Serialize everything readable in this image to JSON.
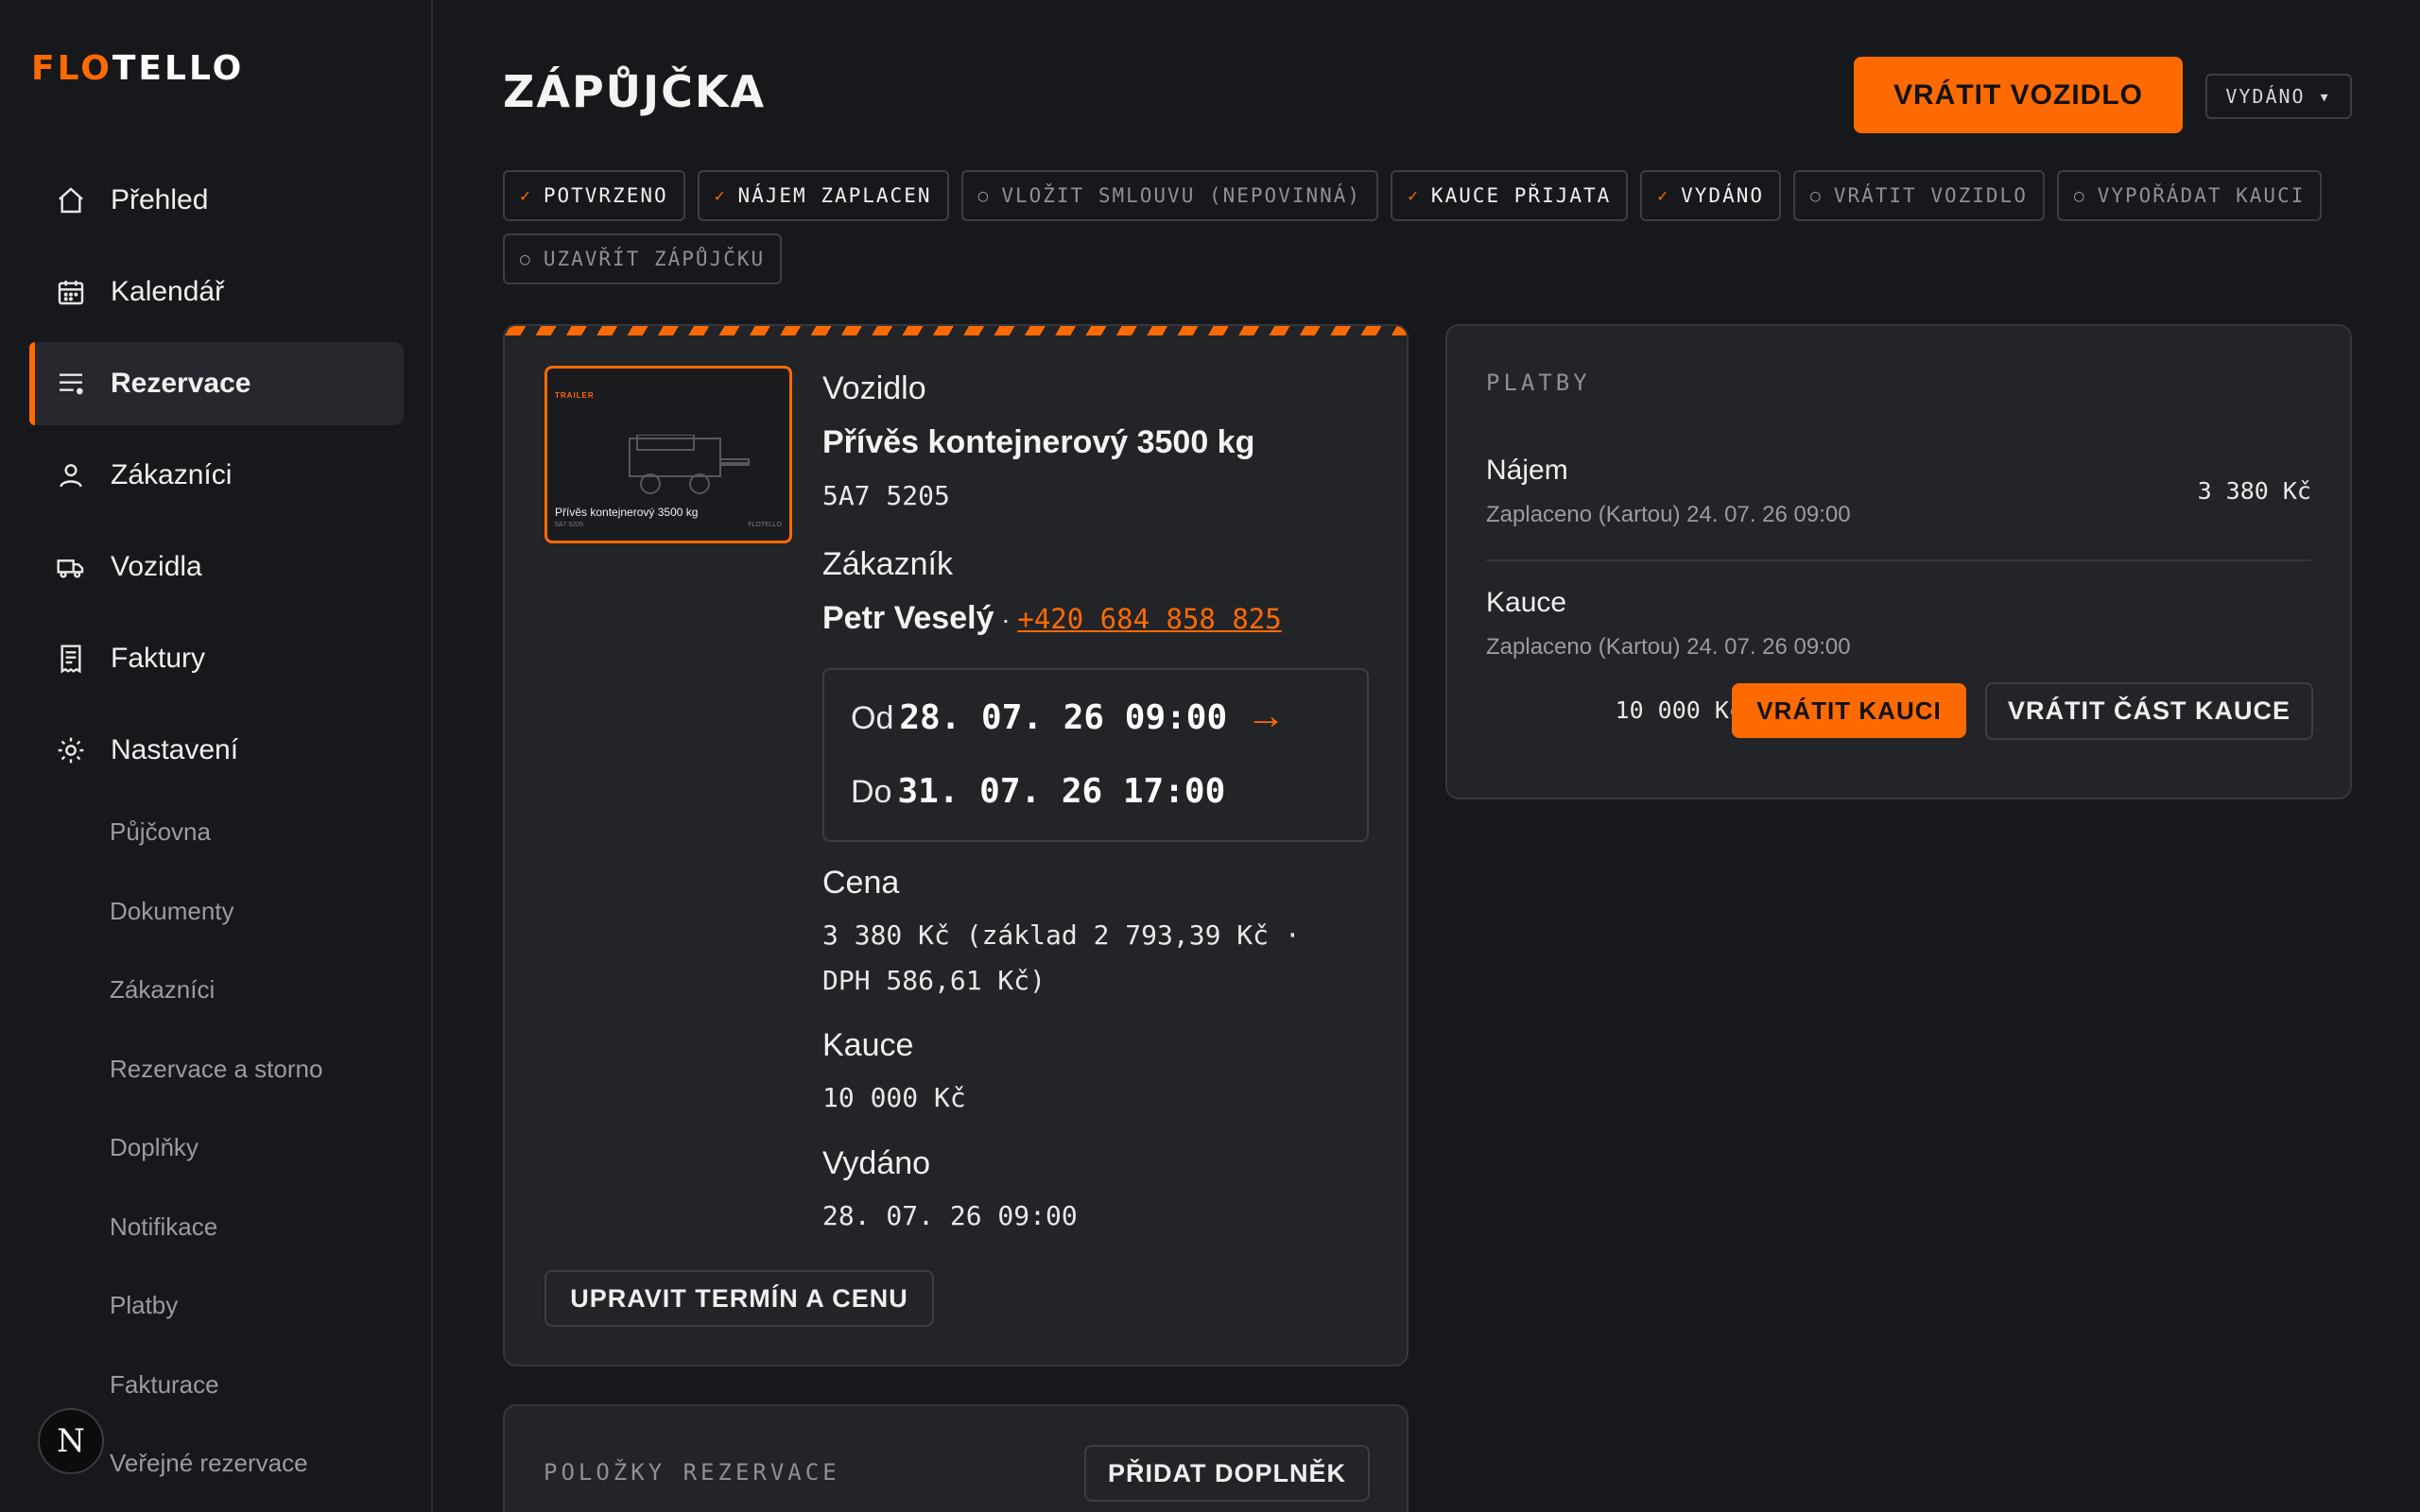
{
  "app": {
    "logo_a": "FLO",
    "logo_b": "TELLO",
    "avatar_letter": "N"
  },
  "sidebar": {
    "items": [
      {
        "label": "Přehled",
        "icon": "home-icon"
      },
      {
        "label": "Kalendář",
        "icon": "calendar-icon"
      },
      {
        "label": "Rezervace",
        "icon": "list-icon",
        "active": true
      },
      {
        "label": "Zákazníci",
        "icon": "user-icon"
      },
      {
        "label": "Vozidla",
        "icon": "truck-icon"
      },
      {
        "label": "Faktury",
        "icon": "receipt-icon"
      },
      {
        "label": "Nastavení",
        "icon": "gear-icon"
      }
    ],
    "subitems": [
      "Půjčovna",
      "Dokumenty",
      "Zákazníci",
      "Rezervace a storno",
      "Doplňky",
      "Notifikace",
      "Platby",
      "Fakturace",
      "Veřejné rezervace"
    ]
  },
  "header": {
    "title": "ZÁPŮJČKA",
    "return_button": "VRÁTIT VOZIDLO",
    "status_select": "VYDÁNO ▾"
  },
  "steps": [
    {
      "label": "POTVRZENO",
      "done": true,
      "mark": "✓"
    },
    {
      "label": "NÁJEM ZAPLACEN",
      "done": true,
      "mark": "✓"
    },
    {
      "label": "VLOŽIT SMLOUVU (NEPOVINNÁ)",
      "done": false,
      "mark": "○"
    },
    {
      "label": "KAUCE PŘIJATA",
      "done": true,
      "mark": "✓"
    },
    {
      "label": "VYDÁNO",
      "done": true,
      "mark": "✓"
    },
    {
      "label": "VRÁTIT VOZIDLO",
      "done": false,
      "mark": "○"
    },
    {
      "label": "VYPOŘÁDAT KAUCI",
      "done": false,
      "mark": "○"
    },
    {
      "label": "UZAVŘÍT ZÁPŮJČKU",
      "done": false,
      "mark": "○"
    }
  ],
  "vehicle": {
    "thumb_tag": "TRAILER",
    "thumb_name": "Přívěs kontejnerový 3500 kg",
    "thumb_plate": "5A7 5205",
    "thumb_brand": "FLOTELLO",
    "label": "Vozidlo",
    "name": "Přívěs kontejnerový 3500 kg",
    "plate": "5A7 5205",
    "customer_label": "Zákazník",
    "customer_name": "Petr Veselý",
    "customer_sep": " · ",
    "customer_phone": "+420 684 858 825",
    "from_label": "Od",
    "from_value": "28. 07. 26 09:00",
    "from_arrow": "→",
    "to_label": "Do",
    "to_value": "31. 07. 26 17:00",
    "price_label": "Cena",
    "price_line1": "3 380 Kč (základ 2 793,39 Kč ·",
    "price_line2": "DPH 586,61 Kč)",
    "deposit_label": "Kauce",
    "deposit_value": "10 000 Kč",
    "issued_label": "Vydáno",
    "issued_value": "28. 07. 26 09:00",
    "edit_button": "UPRAVIT TERMÍN A CENU"
  },
  "payments": {
    "title": "PLATBY",
    "rent_name": "Nájem",
    "rent_status": "Zaplaceno (Kartou) 24. 07. 26 09:00",
    "rent_amount": "3 380 Kč",
    "deposit_name": "Kauce",
    "deposit_status": "Zaplaceno (Kartou) 24. 07. 26 09:00",
    "deposit_amount": "10 000 Kč",
    "return_deposit_button": "VRÁTIT KAUCI",
    "return_part_button": "VRÁTIT ČÁST KAUCE"
  },
  "items": {
    "title": "POLOŽKY REZERVACE",
    "add_button": "PŘIDAT DOPLNĚK"
  },
  "colors": {
    "accent": "#ff6a00",
    "background": "#17181b",
    "card": "#222428",
    "border": "#34373c"
  }
}
